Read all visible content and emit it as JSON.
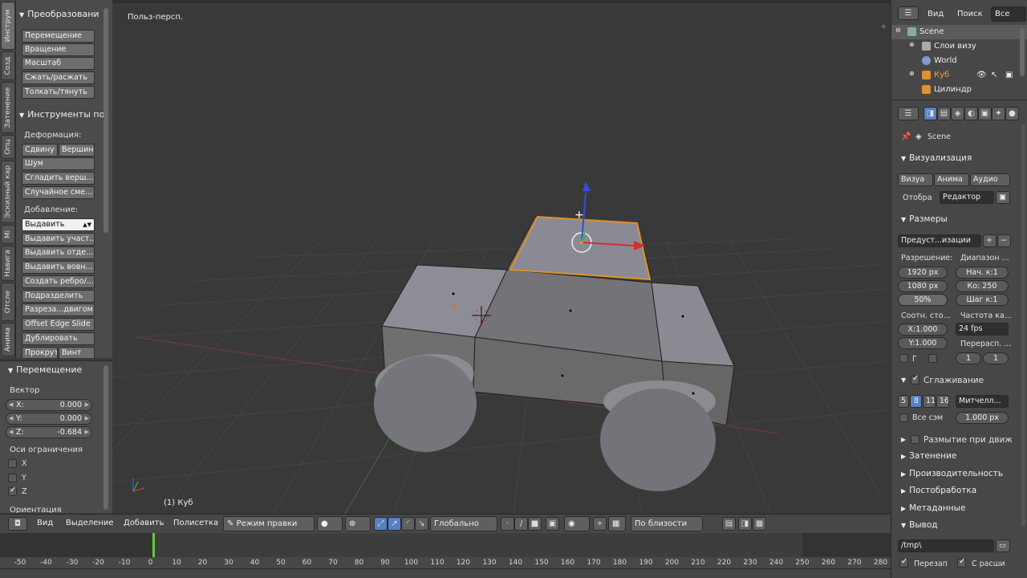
{
  "tabs_vertical": [
    "Инструм",
    "Созд",
    "Затенение",
    "Опц",
    "Эскизный кар",
    "Mi",
    "Навига",
    "Отсле",
    "Анима"
  ],
  "tool_panel": {
    "transform_header": "Преобразовани",
    "transform_buttons": [
      "Перемещение",
      "Вращение",
      "Масштаб",
      "Сжать/расжать",
      "Толкать/тянуть"
    ],
    "mesh_tools_header": "Инструменты по",
    "deform_label": "Деформация:",
    "deform_buttons": [
      "Сдвину",
      "Вершин",
      "Шум",
      "Сгладить верш...",
      "Случайное сме..."
    ],
    "add_label": "Добавление:",
    "add_buttons": [
      "Выдавить",
      "Выдавить участ...",
      "Выдавить отде...",
      "Выдавить вовн...",
      "Создать ребро/...",
      "Подразделить",
      "Разреза...двигом",
      "Offset Edge Slide",
      "Дублировать"
    ],
    "last_row": [
      "Прокрут",
      "Винт"
    ]
  },
  "operator_panel": {
    "header": "Перемещение",
    "vector_label": "Вектор",
    "fields": [
      {
        "label": "X:",
        "value": "0.000"
      },
      {
        "label": "Y:",
        "value": "0.000"
      },
      {
        "label": "Z:",
        "value": "-0.684"
      }
    ],
    "constraint_label": "Оси ограничения",
    "axes": [
      {
        "label": "X",
        "checked": false
      },
      {
        "label": "Y",
        "checked": false
      },
      {
        "label": "Z",
        "checked": true
      }
    ],
    "orientation_label": "Ориентация"
  },
  "viewport": {
    "title": "Польз-персп.",
    "object_label": "(1) Куб"
  },
  "header_bar": {
    "menus": [
      "Вид",
      "Выделение",
      "Добавить",
      "Полисетка"
    ],
    "mode": "Режим правки",
    "orientation": "Глобально",
    "snap": "По близости"
  },
  "timeline": {
    "ticks": [
      "-50",
      "-40",
      "-30",
      "-20",
      "-10",
      "0",
      "10",
      "20",
      "30",
      "40",
      "50",
      "60",
      "70",
      "80",
      "90",
      "100",
      "110",
      "120",
      "130",
      "140",
      "150",
      "160",
      "170",
      "180",
      "190",
      "200",
      "210",
      "220",
      "230",
      "240",
      "250",
      "260",
      "270",
      "280"
    ],
    "current_frame": 1
  },
  "outliner": {
    "header_menus": [
      "Вид",
      "Поиск"
    ],
    "scope": "Все сце",
    "rows": [
      {
        "label": "Scene",
        "icon": "scene-icon"
      },
      {
        "label": "Слои визу",
        "icon": "render-layers-icon"
      },
      {
        "label": "World",
        "icon": "world-icon"
      },
      {
        "label": "Куб",
        "icon": "mesh-icon"
      },
      {
        "label": "Цилиндр",
        "icon": "mesh-icon"
      }
    ]
  },
  "properties": {
    "scene_label": "Scene",
    "render_header": "Визуализация",
    "render_buttons": [
      "Визуа",
      "Анима",
      "Аудио"
    ],
    "display_label": "Отобра",
    "display_value": "Редактор",
    "dimensions_header": "Размеры",
    "preset": "Предуст...изации",
    "resolution_label": "Разрешение:",
    "range_label": "Диапазон ...",
    "res_x": "1920 px",
    "res_y": "1080 px",
    "res_pct": "50%",
    "frame_start": "Нач. к:1",
    "frame_end": "Ко:  250",
    "frame_step": "Шаг к:1",
    "aspect_label": "Соотн. сто...",
    "fps_label": "Частота ка...",
    "aspect_x": "X:1.000",
    "aspect_y": "Y:1.000",
    "fps": "24 fps",
    "remap_label": "Перерасп. ...",
    "remap_old": "1",
    "remap_new": "1",
    "border_label": "Г",
    "aa_header": "Сглаживание",
    "aa_samples": [
      "5",
      "8",
      "11",
      "16"
    ],
    "aa_filter": "Митчелл...",
    "full_sample": "Все сэм",
    "aa_size": "1.000 px",
    "motion_blur": "Размытие при движ",
    "shading": "Затенение",
    "performance": "Производительность",
    "post": "Постобработка",
    "metadata": "Метаданные",
    "output": "Вывод",
    "output_path": "/tmp\\",
    "overwrite": "Перезап",
    "extensions": "С расши"
  }
}
